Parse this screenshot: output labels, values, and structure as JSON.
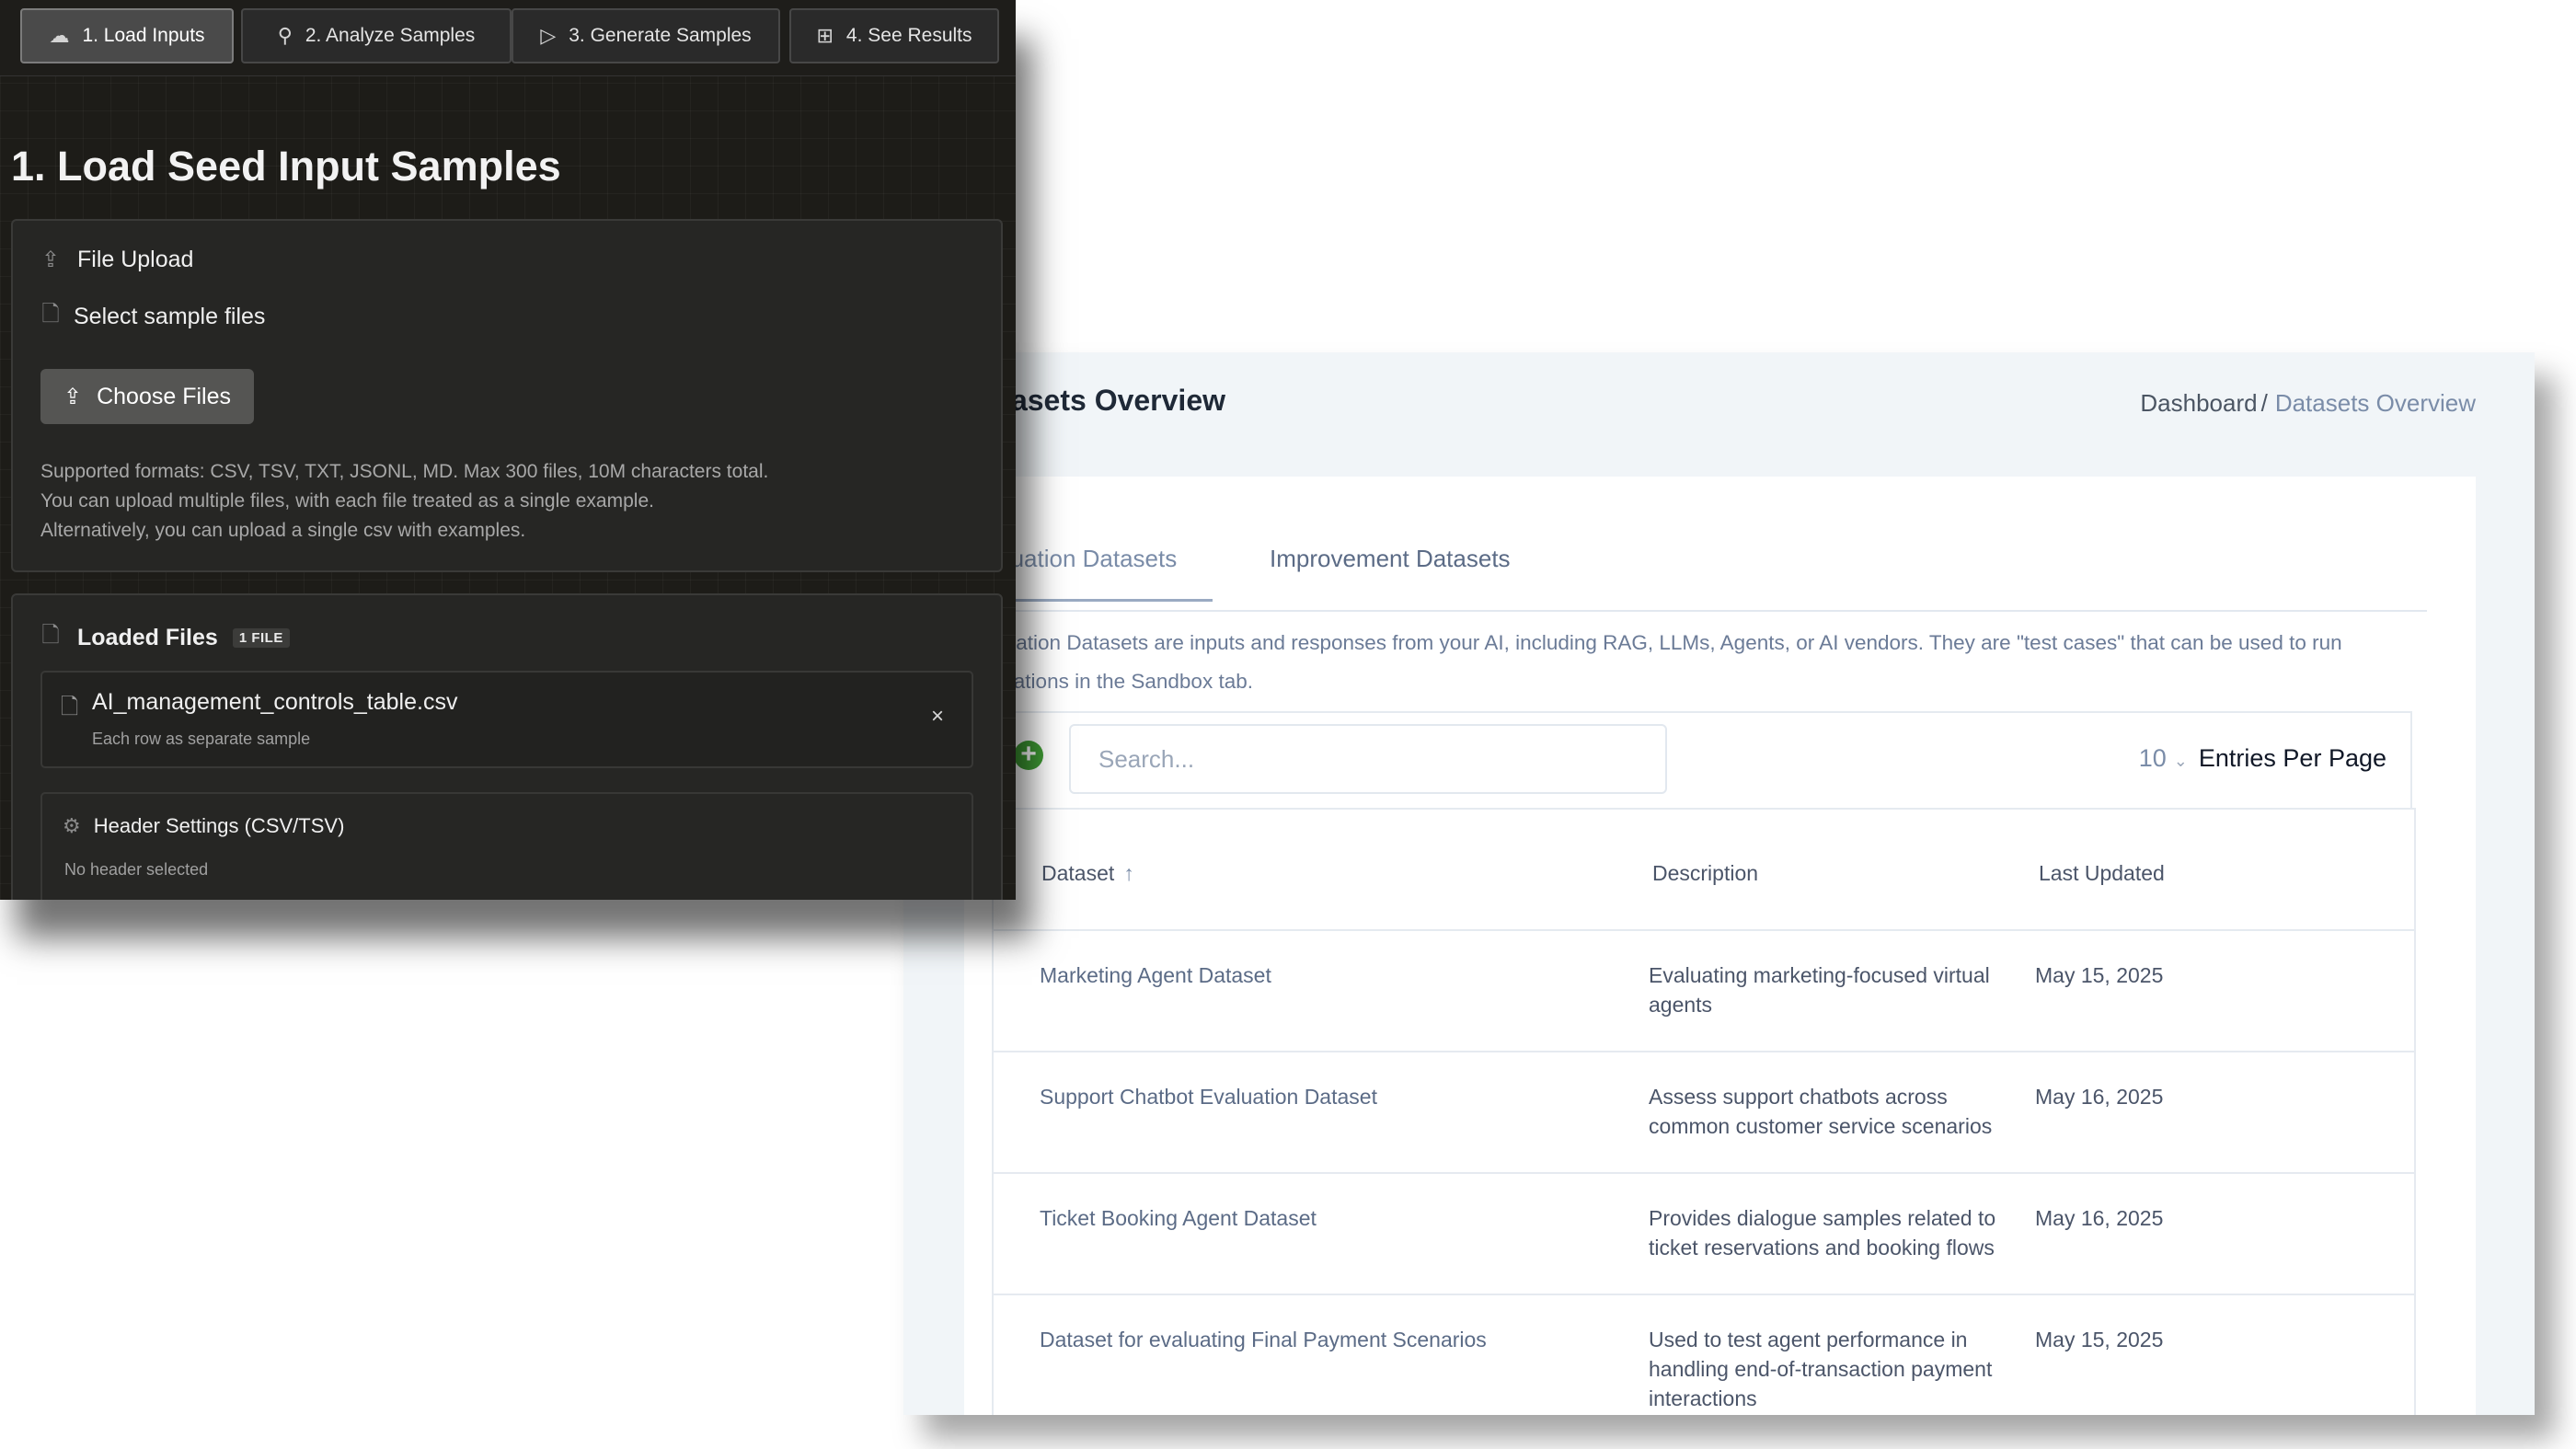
{
  "datasets_window": {
    "title": "Datasets Overview",
    "breadcrumb": {
      "root": "Dashboard",
      "separator": "/",
      "current": "Datasets Overview"
    },
    "tabs": [
      {
        "label": "Evaluation Datasets",
        "active": true
      },
      {
        "label": "Improvement Datasets",
        "active": false
      }
    ],
    "description": "Evaluation Datasets are inputs and responses from your AI, including RAG, LLMs, Agents, or AI vendors. They are \"test cases\" that can be used to run evaluations in the Sandbox tab.",
    "add_icon": "plus-circle-icon",
    "search": {
      "placeholder": "Search...",
      "value": ""
    },
    "entries": {
      "value": "10",
      "label": "Entries Per Page"
    },
    "columns": [
      "Dataset",
      "Description",
      "Last Updated"
    ],
    "sort_icon": "arrow-up-icon",
    "rows": [
      {
        "dataset": "Marketing Agent Dataset",
        "description": "Evaluating marketing-focused virtual agents",
        "updated": "May 15, 2025"
      },
      {
        "dataset": "Support Chatbot Evaluation Dataset",
        "description": "Assess support chatbots across common customer service scenarios",
        "updated": "May 16, 2025"
      },
      {
        "dataset": "Ticket Booking Agent Dataset",
        "description": "Provides dialogue samples related to ticket reservations and booking flows",
        "updated": "May 16, 2025"
      },
      {
        "dataset": "Dataset for evaluating Final Payment Scenarios",
        "description": "Used to test agent performance in handling end-of-transaction payment interactions",
        "updated": "May 15, 2025"
      }
    ],
    "colors": {
      "accent_green": "#3f9b34",
      "link": "#5b6b86"
    }
  },
  "wizard": {
    "steps": [
      {
        "label": "1. Load Inputs",
        "icon": "upload-cloud-icon",
        "active": true
      },
      {
        "label": "2. Analyze Samples",
        "icon": "search-icon",
        "active": false
      },
      {
        "label": "3. Generate Samples",
        "icon": "play-icon",
        "active": false
      },
      {
        "label": "4. See Results",
        "icon": "grid-icon",
        "active": false
      }
    ],
    "heading": "1. Load Seed Input Samples",
    "upload": {
      "title": "File Upload",
      "select_label": "Select sample files",
      "button": "Choose Files",
      "hint_lines": [
        "Supported formats: CSV, TSV, TXT, JSONL, MD. Max 300 files, 10M characters total.",
        "You can upload multiple files, with each file treated as a single example.",
        "Alternatively, you can upload a single csv with examples."
      ]
    },
    "loaded": {
      "title": "Loaded Files",
      "badge": "1 FILE",
      "file": {
        "name": "AI_management_controls_table.csv",
        "sub": "Each row as separate sample",
        "remove": "×"
      },
      "header_settings": {
        "title": "Header Settings (CSV/TSV)",
        "sub": "No header selected"
      }
    }
  }
}
